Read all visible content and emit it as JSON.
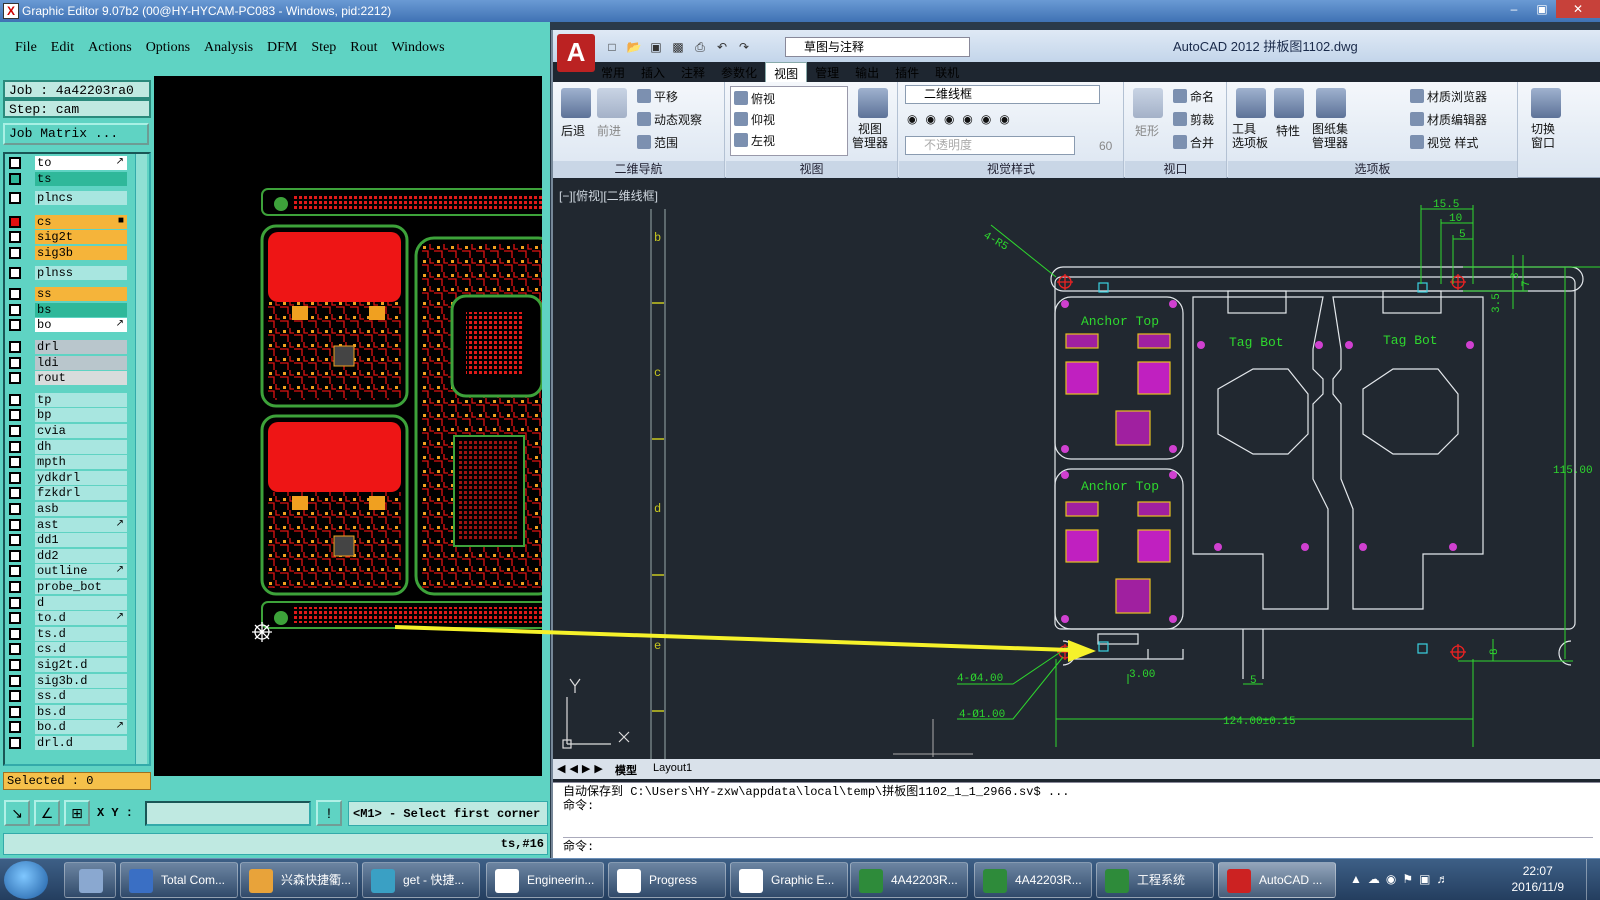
{
  "ge": {
    "title": "Graphic Editor 9.07b2 (00@HY-HYCAM-PC083 - Windows, pid:2212)",
    "menu": [
      "File",
      "Edit",
      "Actions",
      "Options",
      "Analysis",
      "DFM",
      "Step",
      "Rout",
      "Windows"
    ],
    "job_line": "Job : 4a42203ra0",
    "step_line": "Step: cam",
    "matrix_label": "Job Matrix ...",
    "layers": [
      {
        "name": "to",
        "color": "#ffffff",
        "mark": "↗"
      },
      {
        "name": "ts",
        "color": "#2fb89a",
        "mark": ""
      },
      {
        "name": "plncs",
        "color": "#a8e6e0",
        "mark": ""
      },
      {
        "name": "cs",
        "color": "#f5b43a",
        "mark": "■"
      },
      {
        "name": "sig2t",
        "color": "#f5b43a",
        "mark": ""
      },
      {
        "name": "sig3b",
        "color": "#f5b43a",
        "mark": ""
      },
      {
        "name": "plnss",
        "color": "#a8e6e0",
        "mark": ""
      },
      {
        "name": "ss",
        "color": "#f5b43a",
        "mark": ""
      },
      {
        "name": "bs",
        "color": "#2fb89a",
        "mark": ""
      },
      {
        "name": "bo",
        "color": "#ffffff",
        "mark": "↗"
      },
      {
        "name": "drl",
        "color": "#b9c6cc",
        "mark": ""
      },
      {
        "name": "ldi",
        "color": "#b9c6cc",
        "mark": ""
      },
      {
        "name": "rout",
        "color": "#d8dcdc",
        "mark": ""
      },
      {
        "name": "tp",
        "color": "#a8e6e0",
        "mark": ""
      },
      {
        "name": "bp",
        "color": "#a8e6e0",
        "mark": ""
      },
      {
        "name": "cvia",
        "color": "#a8e6e0",
        "mark": ""
      },
      {
        "name": "dh",
        "color": "#a8e6e0",
        "mark": ""
      },
      {
        "name": "mpth",
        "color": "#a8e6e0",
        "mark": ""
      },
      {
        "name": "ydkdrl",
        "color": "#a8e6e0",
        "mark": ""
      },
      {
        "name": "fzkdrl",
        "color": "#a8e6e0",
        "mark": ""
      },
      {
        "name": "asb",
        "color": "#a8e6e0",
        "mark": ""
      },
      {
        "name": "ast",
        "color": "#a8e6e0",
        "mark": "↗"
      },
      {
        "name": "dd1",
        "color": "#a8e6e0",
        "mark": ""
      },
      {
        "name": "dd2",
        "color": "#a8e6e0",
        "mark": ""
      },
      {
        "name": "outline",
        "color": "#a8e6e0",
        "mark": "↗"
      },
      {
        "name": "probe_bot",
        "color": "#a8e6e0",
        "mark": ""
      },
      {
        "name": "d",
        "color": "#a8e6e0",
        "mark": ""
      },
      {
        "name": "to.d",
        "color": "#a8e6e0",
        "mark": "↗"
      },
      {
        "name": "ts.d",
        "color": "#a8e6e0",
        "mark": ""
      },
      {
        "name": "cs.d",
        "color": "#a8e6e0",
        "mark": ""
      },
      {
        "name": "sig2t.d",
        "color": "#a8e6e0",
        "mark": ""
      },
      {
        "name": "sig3b.d",
        "color": "#a8e6e0",
        "mark": ""
      },
      {
        "name": "ss.d",
        "color": "#a8e6e0",
        "mark": ""
      },
      {
        "name": "bs.d",
        "color": "#a8e6e0",
        "mark": ""
      },
      {
        "name": "bo.d",
        "color": "#a8e6e0",
        "mark": "↗"
      },
      {
        "name": "drl.d",
        "color": "#a8e6e0",
        "mark": ""
      }
    ],
    "selected": "Selected : 0",
    "xy_label": "X Y :",
    "xy_value": "",
    "prompt": "<M1> - Select first corner",
    "status": "ts,#16"
  },
  "acad": {
    "logo": "A",
    "workspace": "草图与注释",
    "caption": "AutoCAD 2012    拼板图1102.dwg",
    "tabs": [
      "常用",
      "插入",
      "注释",
      "参数化",
      "视图",
      "管理",
      "输出",
      "插件",
      "联机"
    ],
    "active_tab": "视图",
    "nav": {
      "back": "后退",
      "fwd": "前进",
      "pan": "平移",
      "orbit": "动态观察",
      "extent": "范围",
      "title": "二维导航"
    },
    "views": {
      "items": [
        "俯视",
        "仰视",
        "左视"
      ],
      "manager": "视图\n管理器",
      "title": "视图"
    },
    "visual": {
      "style": "二维线框",
      "opacity": "不透明度",
      "opacity_val": "60",
      "title": "视觉样式"
    },
    "viewport_panel": {
      "rect": "矩形",
      "name": "命名",
      "clip": "剪裁",
      "merge": "合并",
      "title": "视口"
    },
    "palettes": {
      "tool": "工具\n选项板",
      "props": "特性",
      "sheet": "图纸集\n管理器",
      "mat_browser": "材质浏览器",
      "mat_editor": "材质编辑器",
      "vis_style": "视觉 样式",
      "title": "选项板"
    },
    "switch": "切换\n窗口",
    "viewport_label": "[−][俯视][二维线框]",
    "ruler_labels": [
      "b",
      "c",
      "d",
      "e"
    ],
    "drawing": {
      "anchor1": "Anchor Top",
      "anchor2": "Anchor Top",
      "tag1": "Tag Bot",
      "tag2": "Tag Bot",
      "dim_r": "4-R5",
      "dim_155": "15.5",
      "dim_10": "10",
      "dim_5a": "5",
      "dim_3": "3",
      "dim_35": "3.5",
      "dim_7": "7",
      "dim_115": "115.00",
      "dim_hole4": "4-Ø4.00",
      "dim_hole1": "4-Ø1.00",
      "dim_300": "3.00",
      "dim_5b": "5",
      "dim_124": "124.00±0.15",
      "dim_8": "8"
    },
    "layout_tabs": [
      "模型",
      "Layout1"
    ],
    "cmd_lines": [
      "自动保存到 C:\\Users\\HY-zxw\\appdata\\local\\temp\\拼板图1102_1_1_2966.sv$ ...",
      "命令:"
    ],
    "cmd_input": "命令:"
  },
  "taskbar": {
    "items": [
      {
        "label": "Total Com...",
        "color": "#3a6fc4"
      },
      {
        "label": "兴森快捷衢...",
        "color": "#e8a33a"
      },
      {
        "label": "get - 快捷...",
        "color": "#3aa0c4"
      },
      {
        "label": "Engineerin...",
        "color": "#ffffff"
      },
      {
        "label": "Progress",
        "color": "#ffffff"
      },
      {
        "label": "Graphic E...",
        "color": "#ffffff"
      },
      {
        "label": "4A42203R...",
        "color": "#2e8b3a"
      },
      {
        "label": "4A42203R...",
        "color": "#2e8b3a"
      },
      {
        "label": "工程系统",
        "color": "#2e8b3a"
      },
      {
        "label": "AutoCAD ...",
        "color": "#c22"
      }
    ],
    "time": "22:07",
    "date": "2016/11/9"
  }
}
